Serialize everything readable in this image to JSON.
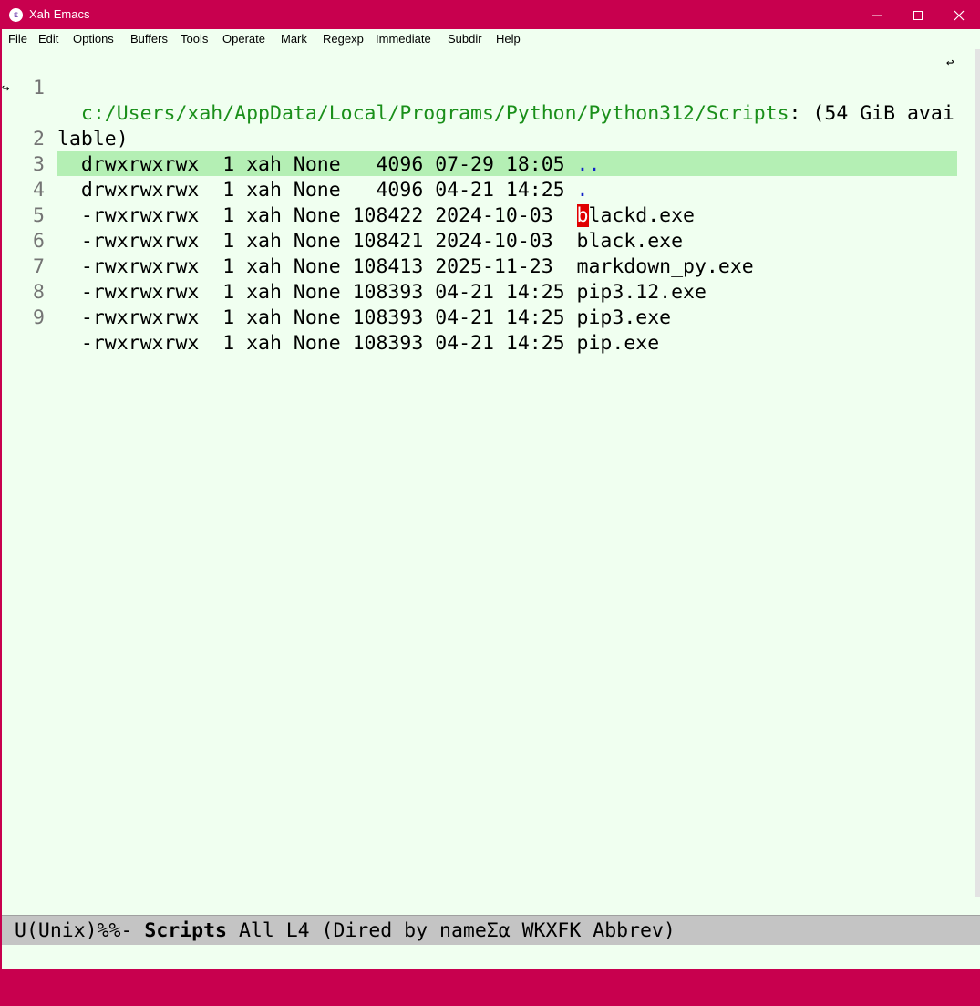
{
  "window": {
    "title": "Xah Emacs",
    "icon": "emacs-icon",
    "controls": [
      "minimize-icon",
      "maximize-icon",
      "close-icon"
    ]
  },
  "menubar": {
    "items": [
      "File",
      "Edit",
      "Options",
      "Buffers",
      "Tools",
      "Operate",
      "Mark",
      "Regexp",
      "Immediate",
      "Subdir",
      "Help"
    ]
  },
  "buffer": {
    "header_path": "c:/Users/xah/AppData/Local/Programs/Python/Python312/Scripts",
    "header_rest": ": (54 GiB avai",
    "header_wrap": "lable)",
    "line_numbers": [
      "1",
      "2",
      "3",
      "4",
      "5",
      "6",
      "7",
      "8",
      "9"
    ],
    "rows": [
      {
        "meta": "  drwxrwxrwx  1 xah None   4096 07-29 18:05 ",
        "name": ".."
      },
      {
        "meta": "  drwxrwxrwx  1 xah None   4096 04-21 14:25 ",
        "name": "."
      },
      {
        "meta": "  -rwxrwxrwx  1 xah None 108422 2024-10-03  ",
        "cursor_char": "b",
        "name": "lackd.exe"
      },
      {
        "meta": "  -rwxrwxrwx  1 xah None 108421 2024-10-03  ",
        "name": "black.exe"
      },
      {
        "meta": "  -rwxrwxrwx  1 xah None 108413 2025-11-23  ",
        "name": "markdown_py.exe"
      },
      {
        "meta": "  -rwxrwxrwx  1 xah None 108393 04-21 14:25 ",
        "name": "pip3.12.exe"
      },
      {
        "meta": "  -rwxrwxrwx  1 xah None 108393 04-21 14:25 ",
        "name": "pip3.exe"
      },
      {
        "meta": "  -rwxrwxrwx  1 xah None 108393 04-21 14:25 ",
        "name": "pip.exe"
      }
    ]
  },
  "modeline": {
    "prefix": "U(Unix)%%- ",
    "buffer_name": "Scripts",
    "suffix": " All L4 (Dired by nameΣα WKXFK Abbrev)"
  },
  "colors": {
    "title_bar": "#c8004e",
    "background": "#f0fff0",
    "highlight": "#b4efb4",
    "dir_path": "#1a8f1a",
    "dir_entry": "#1020c8",
    "cursor": "#e00000",
    "modeline": "#c4c4c4"
  }
}
